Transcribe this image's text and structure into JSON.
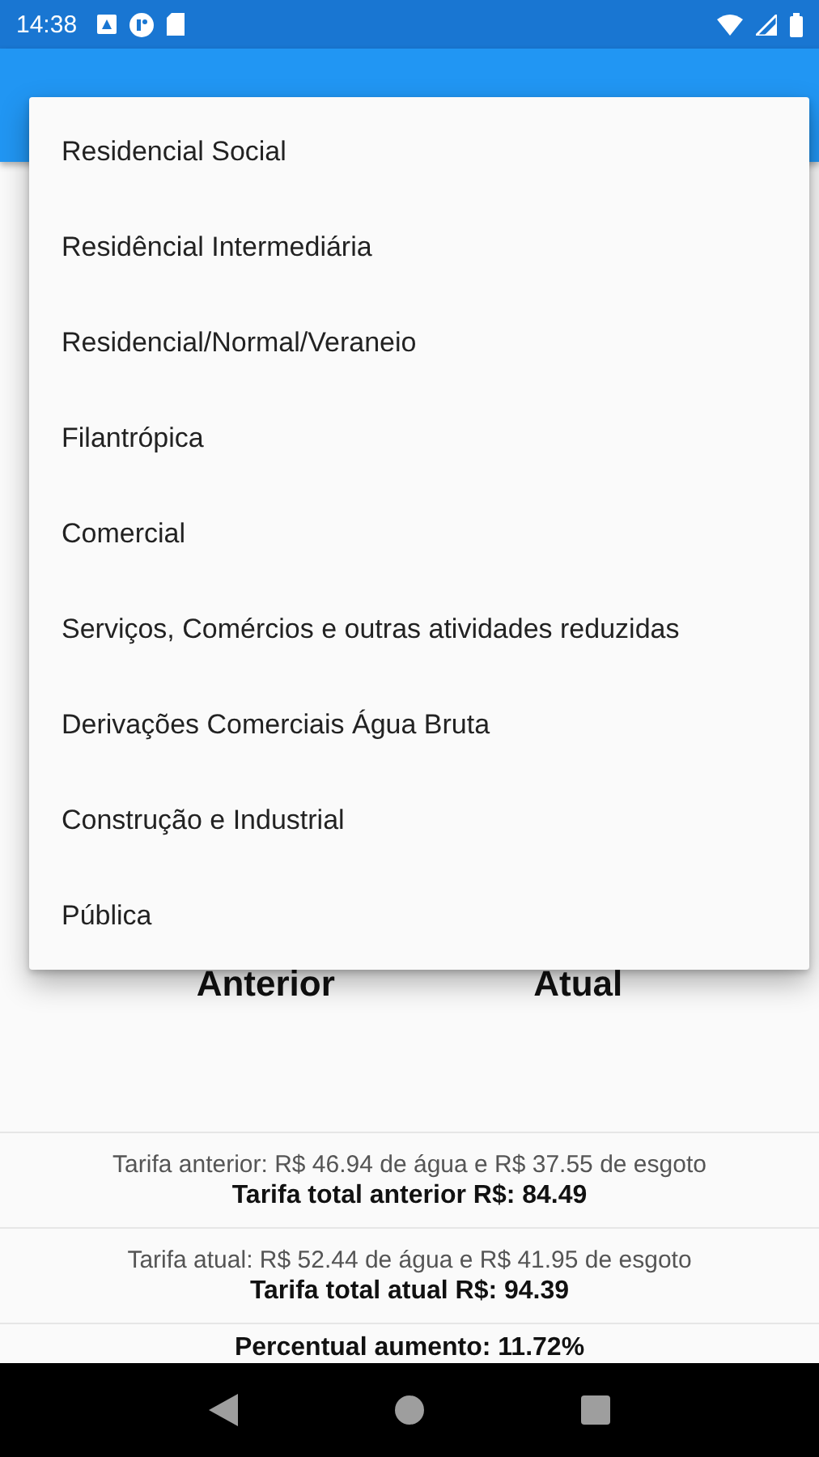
{
  "status_bar": {
    "time": "14:38"
  },
  "columns": [
    {
      "title": "Anterior"
    },
    {
      "title": "Atual"
    }
  ],
  "tariffs": [
    {
      "detail": "Tarifa anterior: R$ 46.94 de água e R$ 37.55 de esgoto",
      "total": "Tarifa total anterior R$: 84.49"
    },
    {
      "detail": "Tarifa atual: R$ 52.44 de água e R$ 41.95 de esgoto",
      "total": "Tarifa total atual R$: 94.39"
    }
  ],
  "increase": "Percentual aumento: 11.72%",
  "dropdown": {
    "options": [
      {
        "label": "Residencial Social"
      },
      {
        "label": "Residêncial Intermediária"
      },
      {
        "label": "Residencial/Normal/Veraneio"
      },
      {
        "label": "Filantrópica"
      },
      {
        "label": "Comercial"
      },
      {
        "label": "Serviços, Comércios e outras atividades reduzidas"
      },
      {
        "label": "Derivações Comerciais Água Bruta"
      },
      {
        "label": "Construção e Industrial"
      },
      {
        "label": "Pública"
      }
    ]
  }
}
